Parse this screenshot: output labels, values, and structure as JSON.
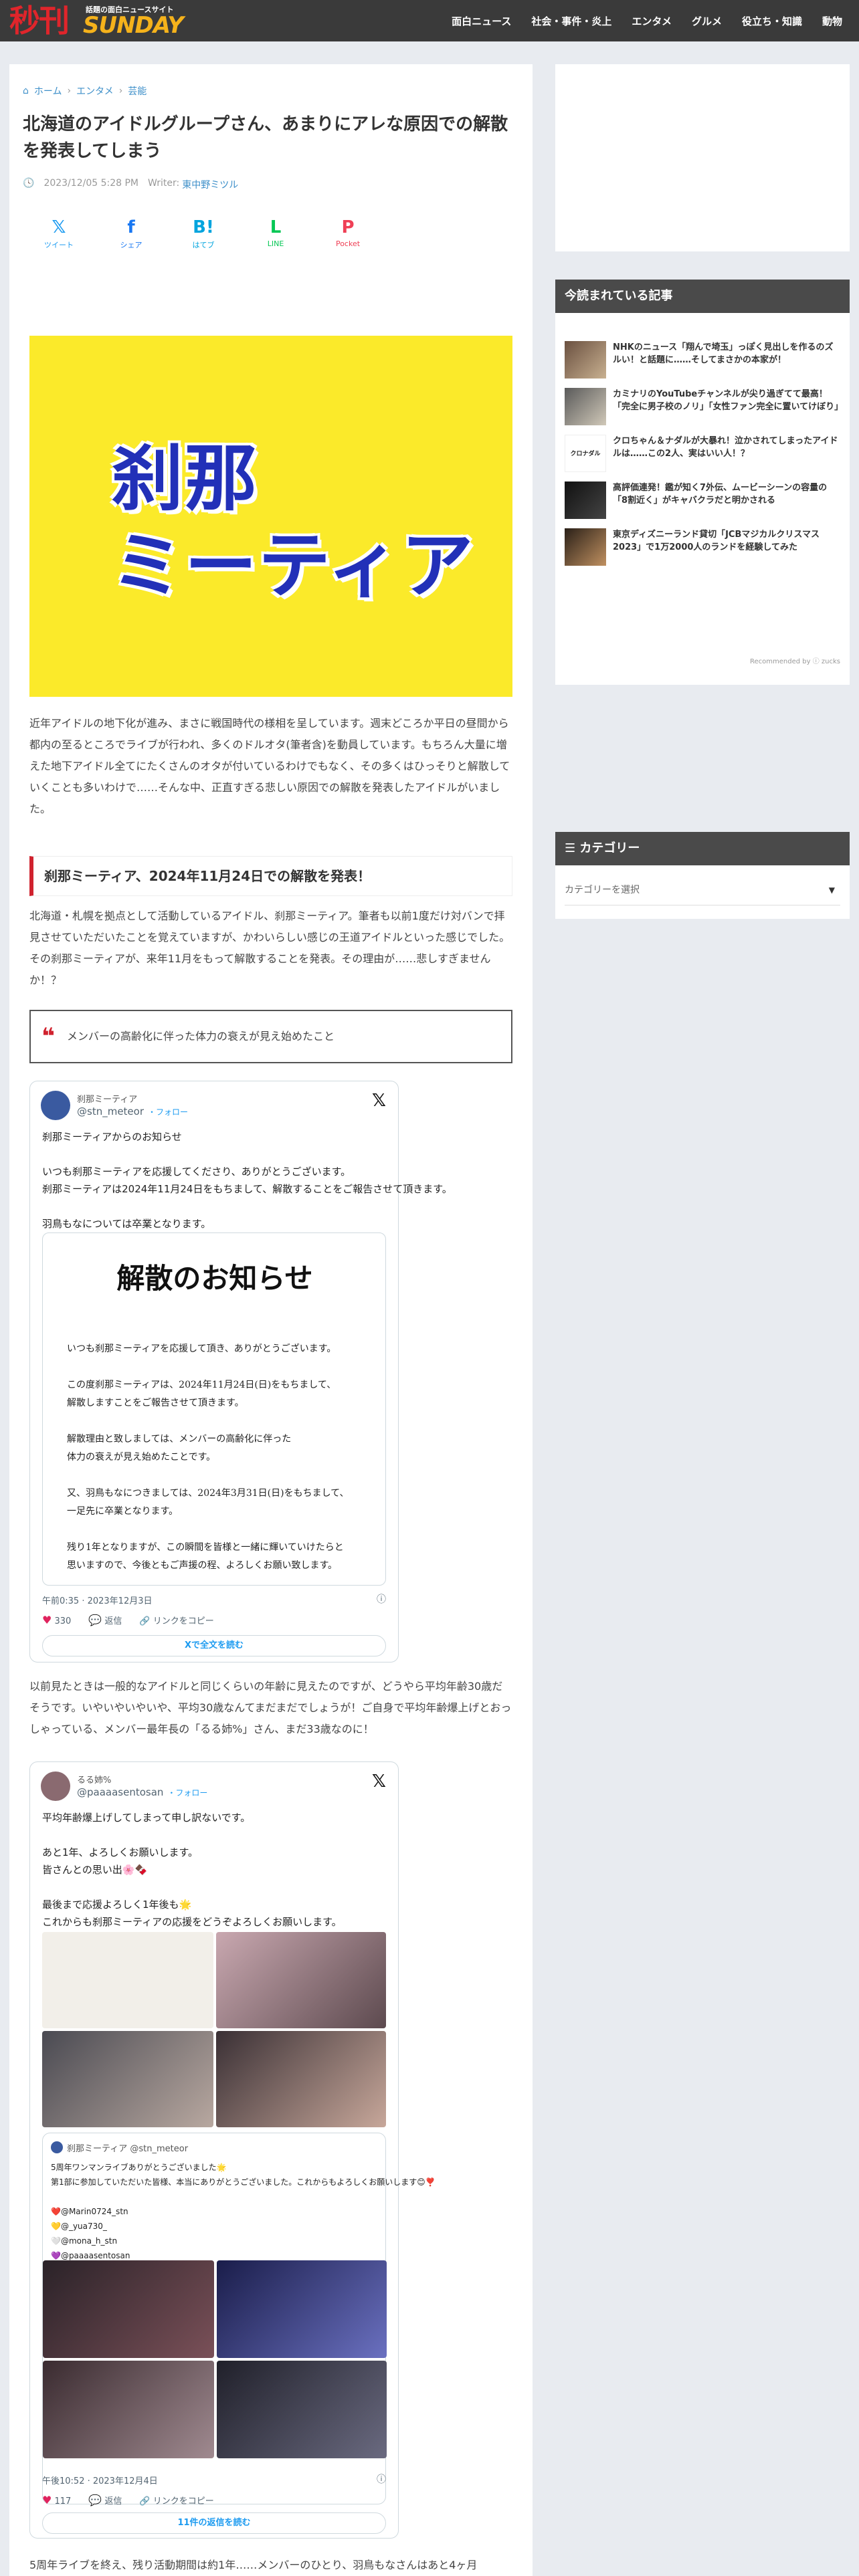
{
  "header": {
    "logo_main": "秒刊",
    "logo_tagline": "話題の面白ニュースサイト",
    "logo_sub": "SUNDAY",
    "nav": [
      "面白ニュース",
      "社会・事件・炎上",
      "エンタメ",
      "グルメ",
      "役立ち・知識",
      "動物"
    ]
  },
  "article": {
    "breadcrumb": [
      "ホーム",
      "エンタメ",
      "芸能"
    ],
    "title": "北海道のアイドルグループさん、あまりにアレな原因での解散を発表してしまう",
    "date": "2023/12/05 5:28 PM",
    "writer_label": "Writer:",
    "writer": "東中野ミツル",
    "shares": [
      {
        "icon": "𝕏",
        "label": "ツイート",
        "color": "#1d9bf0"
      },
      {
        "icon": "f",
        "label": "シェア",
        "color": "#1877f2"
      },
      {
        "icon": "B!",
        "label": "はてブ",
        "color": "#00a4de"
      },
      {
        "icon": "L",
        "label": "LINE",
        "color": "#06c755"
      },
      {
        "icon": "P",
        "label": "Pocket",
        "color": "#ef4056"
      }
    ],
    "hero_text": "刹那\nミーティア",
    "intro": "近年アイドルの地下化が進み、まさに戦国時代の様相を呈しています。週末どころか平日の昼間から都内の至るところでライブが行われ、多くのドルオタ(筆者含)を動員しています。もちろん大量に増えた地下アイドル全てにたくさんのオタが付いているわけでもなく、その多くはひっそりと解散していくことも多いわけで……そんな中、正直すぎる悲しい原因での解散を発表したアイドルがいました。",
    "heading": "刹那ミーティア、2024年11月24日での解散を発表！",
    "para2": "北海道・札幌を拠点として活動しているアイドル、刹那ミーティア。筆者も以前1度だけ対バンで拝見させていただいたことを覚えていますが、かわいらしい感じの王道アイドルといった感じでした。その刹那ミーティアが、来年11月をもって解散することを発表。その理由が……悲しすぎませんか！？",
    "quote": "メンバーの高齢化に伴った体力の衰えが見え始めたこと",
    "para3": "以前見たときは一般的なアイドルと同じくらいの年齢に見えたのですが、どうやら平均年齢30歳だそうです。いやいやいやいや、平均30歳なんてまだまだでしょうが！ご自身で平均年齢爆上げとおっしゃっている、メンバー最年長の「るる姉%」さん、まだ33歳なのに！",
    "para4": "5周年ライブを終え、残り活動期間は約1年……メンバーのひとり、羽鳥もなさんはあと4ヶ月"
  },
  "tweet1": {
    "name": "刹那ミーティア",
    "handle": "@stn_meteor",
    "follow": "・フォロー",
    "text": "刹那ミーティアからのお知らせ\n\nいつも刹那ミーティアを応援してくださり、ありがとうございます。\n刹那ミーティアは2024年11月24日をもちまして、解散することをご報告させて頂きます。\n\n羽鳥もなについては卒業となります。\n詳しくは画像をご確認ください。",
    "notice_title": "解散のお知らせ",
    "notice_body": "いつも刹那ミーティアを応援して頂き、ありがとうございます。\n\nこの度刹那ミーティアは、2024年11月24日(日)をもちまして、\n解散しますことをご報告させて頂きます。\n\n解散理由と致しましては、メンバーの高齢化に伴った\n体力の衰えが見え始めたことです。\n\n又、羽鳥もなにつきましては、2024年3月31日(日)をもちまして、\n一足先に卒業となります。\n\n残り1年となりますが、この瞬間を皆様と一緒に輝いていけたらと\n思いますので、今後ともご声援の程、よろしくお願い致します。",
    "time": "午前0:35 · 2023年12月3日",
    "likes": "330",
    "reply": "返信",
    "copy": "リンクをコピー",
    "button": "Xで全文を読む"
  },
  "tweet2": {
    "name": "るる姉%",
    "handle": "@paaaasentosan",
    "follow": "・フォロー",
    "text": "平均年齢爆上げしてしまって申し訳ないです。\n\nあと1年、よろしくお願いします。\n皆さんとの思い出🌸🍫\n\n最後まで応援よろしく1年後も🌟\nこれからも刹那ミーティアの応援をどうぞよろしくお願いします。",
    "quoted_name": "刹那ミーティア",
    "quoted_handle": "@stn_meteor",
    "quoted_text": "5周年ワンマンライブありがとうございました🌟\n第1部に参加していただいた皆様、本当にありがとうございました。これからもよろしくお願いします😊❣️\n\n❤️@Marin0724_stn\n💛@_yua730_\n🤍@mona_h_stn\n💜@paaaasentosan",
    "time": "午後10:52 · 2023年12月4日",
    "likes": "117",
    "reply": "返信",
    "copy": "リンクをコピー",
    "button": "11件の返信を読む"
  },
  "sidebar": {
    "ranking_title": "今読まれている記事",
    "ranking": [
      "NHKのニュース「翔んで埼玉」っぽく見出しを作るのズルい！と話題に……そしてまさかの本家が！",
      "カミナリのYouTubeチャンネルが尖り過ぎてて最高！「完全に男子校のノリ」「女性ファン完全に置いてけぼり」",
      "クロちゃん＆ナダルが大暴れ！泣かされてしまったアイドルは……この2人、実はいい人！？",
      "高評価連発！鑑が知く7外伝、ムービーシーンの容量の「8割近く」がキャバクラだと明かされる",
      "東京ディズニーランド貸切「JCBマジカルクリスマス2023」で1万2000人のランドを経験してみた"
    ],
    "recommended": "Recommended by ⓘ zucks",
    "category_title": "カテゴリー",
    "category_select": "カテゴリーを選択",
    "category_arrow": "▼"
  },
  "colors": {
    "accent_red": "#d0222e",
    "link_blue": "#3d8fc9",
    "hero_yellow": "#fbea2a"
  }
}
